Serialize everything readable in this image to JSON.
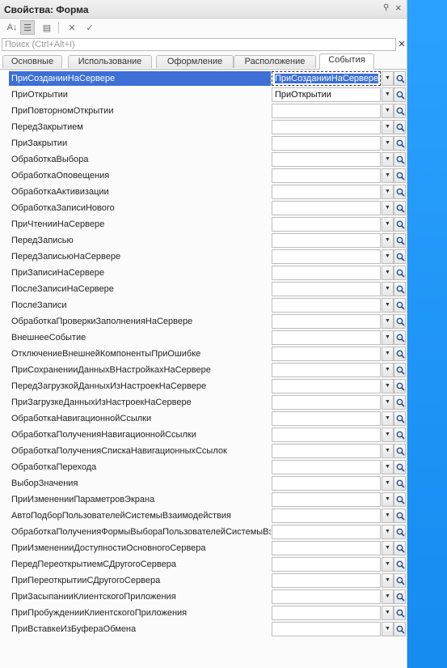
{
  "window": {
    "title": "Свойства: Форма",
    "pin_icon": "pin-icon",
    "close_icon": "close-icon",
    "pin_glyph": "⚲",
    "close_glyph": "×"
  },
  "toolbar": {
    "buttons": [
      {
        "name": "sort-alphabet-button",
        "glyph": "A↓",
        "active": false
      },
      {
        "name": "group-categories-button",
        "glyph": "☰",
        "active": true
      },
      {
        "name": "show-only-changed-button",
        "glyph": "▤",
        "active": false
      },
      {
        "name": "cancel-button",
        "glyph": "✕",
        "active": false
      },
      {
        "name": "confirm-button",
        "glyph": "✓",
        "active": false
      }
    ]
  },
  "search": {
    "placeholder": "Поиск (Ctrl+Alt+I)",
    "clear_glyph": "✕"
  },
  "tabs": [
    {
      "label": "Основные",
      "active": false
    },
    {
      "label": "Использование",
      "active": false
    },
    {
      "label": "Оформление",
      "active": false
    },
    {
      "label": "Расположение",
      "active": false
    },
    {
      "label": "События",
      "active": true
    }
  ],
  "events": [
    {
      "name": "ПриСозданииНаСервере",
      "value": "ПриСозданииНаСервере",
      "selected": true
    },
    {
      "name": "ПриОткрытии",
      "value": "ПриОткрытии",
      "selected": false
    },
    {
      "name": "ПриПовторномОткрытии",
      "value": "",
      "selected": false
    },
    {
      "name": "ПередЗакрытием",
      "value": "",
      "selected": false
    },
    {
      "name": "ПриЗакрытии",
      "value": "",
      "selected": false
    },
    {
      "name": "ОбработкаВыбора",
      "value": "",
      "selected": false
    },
    {
      "name": "ОбработкаОповещения",
      "value": "",
      "selected": false
    },
    {
      "name": "ОбработкаАктивизации",
      "value": "",
      "selected": false
    },
    {
      "name": "ОбработкаЗаписиНового",
      "value": "",
      "selected": false
    },
    {
      "name": "ПриЧтенииНаСервере",
      "value": "",
      "selected": false
    },
    {
      "name": "ПередЗаписью",
      "value": "",
      "selected": false
    },
    {
      "name": "ПередЗаписьюНаСервере",
      "value": "",
      "selected": false
    },
    {
      "name": "ПриЗаписиНаСервере",
      "value": "",
      "selected": false
    },
    {
      "name": "ПослеЗаписиНаСервере",
      "value": "",
      "selected": false
    },
    {
      "name": "ПослеЗаписи",
      "value": "",
      "selected": false
    },
    {
      "name": "ОбработкаПроверкиЗаполненияНаСервере",
      "value": "",
      "selected": false
    },
    {
      "name": "ВнешнееСобытие",
      "value": "",
      "selected": false
    },
    {
      "name": "ОтключениеВнешнейКомпонентыПриОшибке",
      "value": "",
      "selected": false
    },
    {
      "name": "ПриСохраненииДанныхВНастройкахНаСервере",
      "value": "",
      "selected": false
    },
    {
      "name": "ПередЗагрузкойДанныхИзНастроекНаСервере",
      "value": "",
      "selected": false
    },
    {
      "name": "ПриЗагрузкеДанныхИзНастроекНаСервере",
      "value": "",
      "selected": false
    },
    {
      "name": "ОбработкаНавигационнойСсылки",
      "value": "",
      "selected": false
    },
    {
      "name": "ОбработкаПолученияНавигационнойСсылки",
      "value": "",
      "selected": false
    },
    {
      "name": "ОбработкаПолученияСпискаНавигационныхСсылок",
      "value": "",
      "selected": false
    },
    {
      "name": "ОбработкаПерехода",
      "value": "",
      "selected": false
    },
    {
      "name": "ВыборЗначения",
      "value": "",
      "selected": false
    },
    {
      "name": "ПриИзмененииПараметровЭкрана",
      "value": "",
      "selected": false
    },
    {
      "name": "АвтоПодборПользователейСистемыВзаимодействия",
      "value": "",
      "selected": false
    },
    {
      "name": "ОбработкаПолученияФормыВыбораПользователейСистемыВз",
      "value": "",
      "selected": false
    },
    {
      "name": "ПриИзмененииДоступностиОсновногоСервера",
      "value": "",
      "selected": false
    },
    {
      "name": "ПередПереоткрытиемСДругогоСервера",
      "value": "",
      "selected": false
    },
    {
      "name": "ПриПереоткрытииСДругогоСервера",
      "value": "",
      "selected": false
    },
    {
      "name": "ПриЗасыпанииКлиентскогоПриложения",
      "value": "",
      "selected": false
    },
    {
      "name": "ПриПробужденииКлиентскогоПриложения",
      "value": "",
      "selected": false
    },
    {
      "name": "ПриВставкеИзБуфераОбмена",
      "value": "",
      "selected": false
    }
  ],
  "row_controls": {
    "dropdown_icon": "chevron-down-icon",
    "dropdown_glyph": "▼",
    "open_icon": "magnifier-icon"
  },
  "colors": {
    "selection": "#3d6fd6",
    "side_accent": "#1e90ff"
  }
}
